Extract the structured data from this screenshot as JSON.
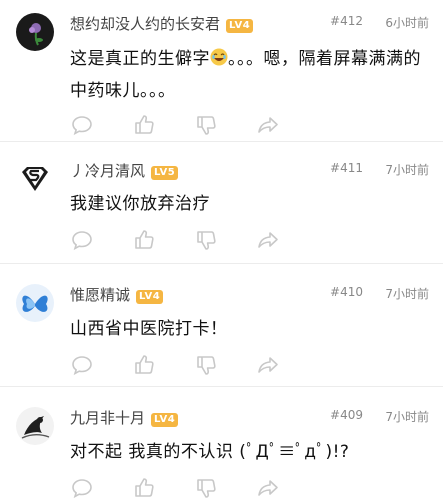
{
  "comments": [
    {
      "username": "想约却没人约的长安君",
      "level": "LV4",
      "floor": "#412",
      "time": "6小时前",
      "content_before_emoji": "这是真正的生僻字",
      "emoji": "laughing-emoji",
      "content_after_emoji": "。。。嗯，隔着屏幕满满的中药味儿。。。",
      "avatar_icon": "flower-dark-avatar"
    },
    {
      "username": "丿冷月清风",
      "level": "LV5",
      "floor": "#411",
      "time": "7小时前",
      "content": "我建议你放弃治疗",
      "avatar_icon": "superman-logo-avatar"
    },
    {
      "username": "惟愿精诚",
      "level": "LV4",
      "floor": "#410",
      "time": "7小时前",
      "content": "山西省中医院打卡！",
      "avatar_icon": "blue-butterfly-avatar"
    },
    {
      "username": "九月非十月",
      "level": "LV4",
      "floor": "#409",
      "time": "7小时前",
      "content": "对不起 我真的不认识 (ﾟДﾟ≡ﾟдﾟ)!?",
      "avatar_icon": "ink-sketch-avatar"
    }
  ],
  "action_icons": [
    "comment-icon",
    "like-icon",
    "dislike-icon",
    "share-icon"
  ],
  "colors": {
    "level_badge": "#f5b642",
    "icon_stroke": "#c8c8c8",
    "meta_text": "#888888"
  }
}
